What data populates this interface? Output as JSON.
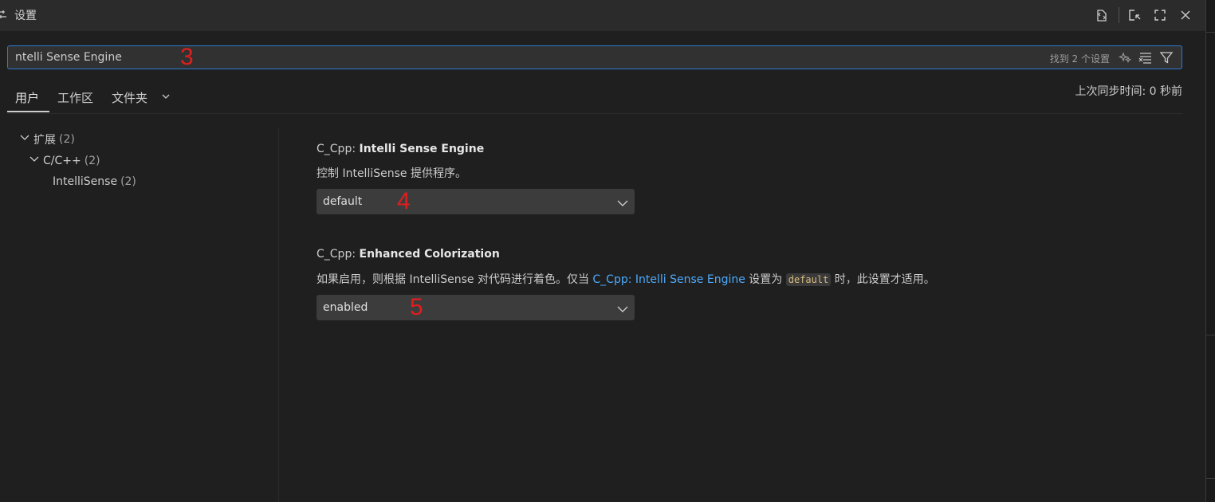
{
  "titlebar": {
    "title": "设置"
  },
  "search": {
    "value": "ntelli Sense Engine",
    "annotation": "3",
    "results": "找到 2 个设置"
  },
  "scope_tabs": [
    {
      "label": "用户",
      "active": true
    },
    {
      "label": "工作区",
      "active": false
    },
    {
      "label": "文件夹",
      "active": false
    }
  ],
  "sync_status": "上次同步时间: 0 秒前",
  "tree": [
    {
      "label": "扩展",
      "count": "(2)"
    },
    {
      "label": "C/C++",
      "count": "(2)"
    },
    {
      "label": "IntelliSense",
      "count": "(2)"
    }
  ],
  "settings": [
    {
      "prefix": "C_Cpp: ",
      "name": "Intelli Sense Engine",
      "description": "控制 IntelliSense 提供程序。",
      "value": "default",
      "annotation": "4"
    },
    {
      "prefix": "C_Cpp: ",
      "name": "Enhanced Colorization",
      "desc_before": "如果启用，则根据 IntelliSense 对代码进行着色。仅当 ",
      "desc_link": "C_Cpp: Intelli Sense Engine",
      "desc_mid": " 设置为 ",
      "desc_code": "default",
      "desc_after": " 时，此设置才适用。",
      "value": "enabled",
      "annotation": "5"
    }
  ],
  "colors": {
    "accent": "#2d7bd1",
    "link": "#4daafc",
    "annotation": "#e01e1e"
  }
}
